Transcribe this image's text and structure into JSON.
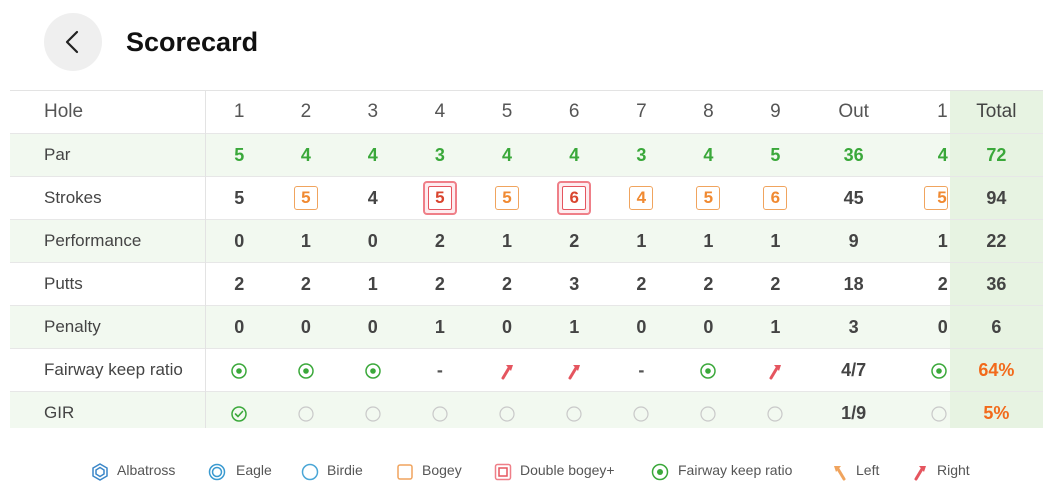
{
  "header": {
    "title": "Scorecard"
  },
  "table": {
    "columns": [
      "Hole",
      "1",
      "2",
      "3",
      "4",
      "5",
      "6",
      "7",
      "8",
      "9",
      "Out",
      "1",
      "Total"
    ],
    "par": {
      "label": "Par",
      "values": [
        "5",
        "4",
        "4",
        "3",
        "4",
        "4",
        "3",
        "4",
        "5"
      ],
      "out": "36",
      "next": "4",
      "total": "72"
    },
    "strokes": {
      "label": "Strokes",
      "values": [
        "5",
        "5",
        "4",
        "5",
        "5",
        "6",
        "4",
        "5",
        "6"
      ],
      "types": [
        "plain",
        "bogey",
        "plain",
        "double",
        "bogey",
        "double",
        "bogey",
        "bogey",
        "bogey"
      ],
      "out": "45",
      "next": "5",
      "total": "94"
    },
    "performance": {
      "label": "Performance",
      "values": [
        "0",
        "1",
        "0",
        "2",
        "1",
        "2",
        "1",
        "1",
        "1"
      ],
      "out": "9",
      "next": "1",
      "total": "22"
    },
    "putts": {
      "label": "Putts",
      "values": [
        "2",
        "2",
        "1",
        "2",
        "2",
        "3",
        "2",
        "2",
        "2"
      ],
      "out": "18",
      "next": "2",
      "total": "36"
    },
    "penalty": {
      "label": "Penalty",
      "values": [
        "0",
        "0",
        "0",
        "1",
        "0",
        "1",
        "0",
        "0",
        "1"
      ],
      "out": "3",
      "next": "0",
      "total": "6"
    },
    "fairway": {
      "label": "Fairway keep ratio",
      "icons": [
        "fairway-hit-icon",
        "fairway-hit-icon",
        "fairway-hit-icon",
        "dash",
        "right-miss-icon",
        "right-miss-icon",
        "dash",
        "fairway-hit-icon",
        "right-miss-icon"
      ],
      "dash": "-",
      "out": "4/7",
      "total": "64%"
    },
    "gir": {
      "label": "GIR",
      "icons": [
        "gir-hit-icon",
        "empty-circle-icon",
        "empty-circle-icon",
        "empty-circle-icon",
        "empty-circle-icon",
        "empty-circle-icon",
        "empty-circle-icon",
        "empty-circle-icon",
        "empty-circle-icon"
      ],
      "out": "1/9",
      "total": "5%"
    }
  },
  "legend": {
    "albatross": "Albatross",
    "eagle": "Eagle",
    "birdie": "Birdie",
    "bogey": "Bogey",
    "double_bogey": "Double bogey+",
    "fairway": "Fairway keep ratio",
    "left": "Left",
    "right": "Right"
  },
  "colors": {
    "green": "#3aa83a",
    "orange": "#f08a32",
    "red": "#e5555f",
    "blue": "#3a86c8",
    "total_bg": "#e7f3e2"
  }
}
